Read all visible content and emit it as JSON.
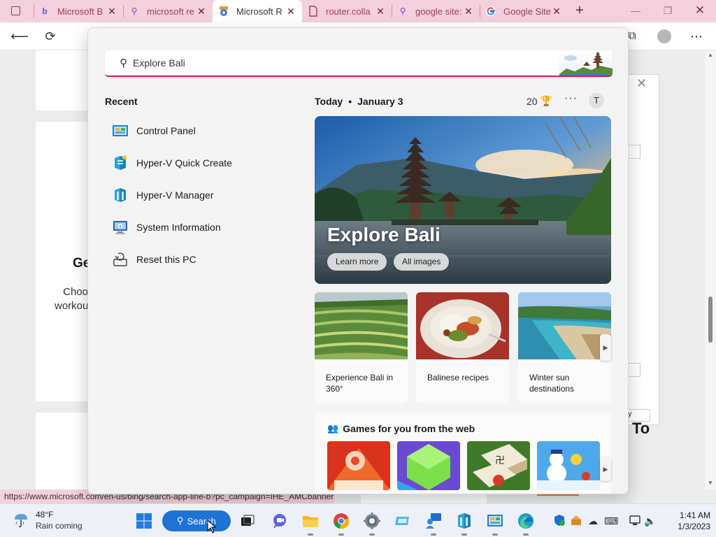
{
  "browser": {
    "tabs": [
      {
        "title": "Microsoft B",
        "favicon": "bing-icon"
      },
      {
        "title": "microsoft re",
        "favicon": "search-icon"
      },
      {
        "title": "Microsoft R",
        "favicon": "rewards-icon"
      },
      {
        "title": "router.colla",
        "favicon": "page-icon"
      },
      {
        "title": "google site:",
        "favicon": "search-icon"
      },
      {
        "title": "Google Site",
        "favicon": "google-icon"
      }
    ],
    "new_tab_glyph": "+",
    "status_url": "https://www.microsoft.com/en-us/bing/search-app-line-b?pc_campaign=IHE_AMCbanner"
  },
  "page_behind": {
    "heading_fragment": "Ge",
    "text_lines": [
      "Choo",
      "workou"
    ],
    "dialog_button_fragment": "y",
    "bottom_fragment": "To"
  },
  "search": {
    "query": "Explore Bali",
    "recent_title": "Recent",
    "recent_items": [
      {
        "label": "Control Panel",
        "icon": "control-panel-icon"
      },
      {
        "label": "Hyper-V Quick Create",
        "icon": "hyperv-quick-create-icon"
      },
      {
        "label": "Hyper-V Manager",
        "icon": "hyperv-manager-icon"
      },
      {
        "label": "System Information",
        "icon": "system-information-icon"
      },
      {
        "label": "Reset this PC",
        "icon": "reset-pc-icon"
      }
    ],
    "today_label": "Today",
    "date": "January 3",
    "rewards_points": "20",
    "profile_initial": "T",
    "hero": {
      "title": "Explore Bali",
      "learn_more": "Learn more",
      "all_images": "All images"
    },
    "tiles": [
      {
        "label": "Experience Bali in 360°"
      },
      {
        "label": "Balinese recipes"
      },
      {
        "label": "Winter sun destinations"
      }
    ],
    "games_title": "Games for you from the web"
  },
  "taskbar": {
    "weather_temp": "48°F",
    "weather_condition": "Rain coming",
    "search_label": "Search",
    "time": "1:41 AM",
    "date": "1/3/2023"
  },
  "colors": {
    "accent_pink": "#f3d0dc",
    "search_underline": "#c4244a",
    "taskbar_search": "#1f72d6"
  }
}
